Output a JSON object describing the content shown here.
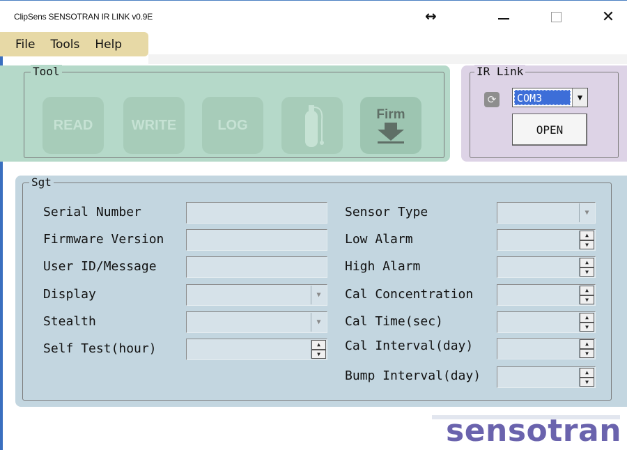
{
  "window": {
    "title": "ClipSens SENSOTRAN IR LINK v0.9E",
    "controls": {
      "resize": "↔",
      "minimize": "minimize-icon",
      "maximize": "maximize-icon",
      "close": "close-icon"
    }
  },
  "menu": {
    "items": [
      "File",
      "Tools",
      "Help"
    ]
  },
  "tool": {
    "legend": "Tool",
    "buttons": [
      {
        "label": "READ",
        "icon": ""
      },
      {
        "label": "WRITE",
        "icon": ""
      },
      {
        "label": "LOG",
        "icon": ""
      },
      {
        "label": "",
        "icon": "gas-cylinder-icon"
      },
      {
        "label": "Firm",
        "icon": "download-arrow-icon"
      }
    ]
  },
  "ir_link": {
    "legend": "IR Link",
    "port": "COM3",
    "open_label": "OPEN",
    "refresh_icon": "refresh-icon"
  },
  "sgt": {
    "legend": "Sgt",
    "left_fields": [
      {
        "label": "Serial Number",
        "type": "text",
        "value": ""
      },
      {
        "label": "Firmware Version",
        "type": "text",
        "value": ""
      },
      {
        "label": "User ID/Message",
        "type": "text",
        "value": ""
      },
      {
        "label": "Display",
        "type": "dropdown",
        "value": ""
      },
      {
        "label": "Stealth",
        "type": "dropdown",
        "value": ""
      },
      {
        "label": "Self Test(hour)",
        "type": "spinner",
        "value": ""
      }
    ],
    "right_fields": [
      {
        "label": "Sensor Type",
        "type": "dropdown",
        "value": ""
      },
      {
        "label": "Low Alarm",
        "type": "spinner",
        "value": ""
      },
      {
        "label": "High Alarm",
        "type": "spinner",
        "value": ""
      },
      {
        "label": "Cal Concentration",
        "type": "spinner",
        "value": ""
      },
      {
        "label": "Cal Time(sec)",
        "type": "spinner",
        "value": ""
      },
      {
        "label": "Cal Interval(day)",
        "type": "spinner",
        "value": ""
      },
      {
        "label": "Bump Interval(day)",
        "type": "spinner",
        "value": ""
      }
    ]
  },
  "brand": {
    "logo_text": "sensotran",
    "color": "#6a63ad"
  },
  "colors": {
    "tool_panel": "#b5d9c9",
    "ir_panel": "#ddd3e6",
    "sgt_panel": "#c3d6e0",
    "menu": "#e7d9a6"
  }
}
